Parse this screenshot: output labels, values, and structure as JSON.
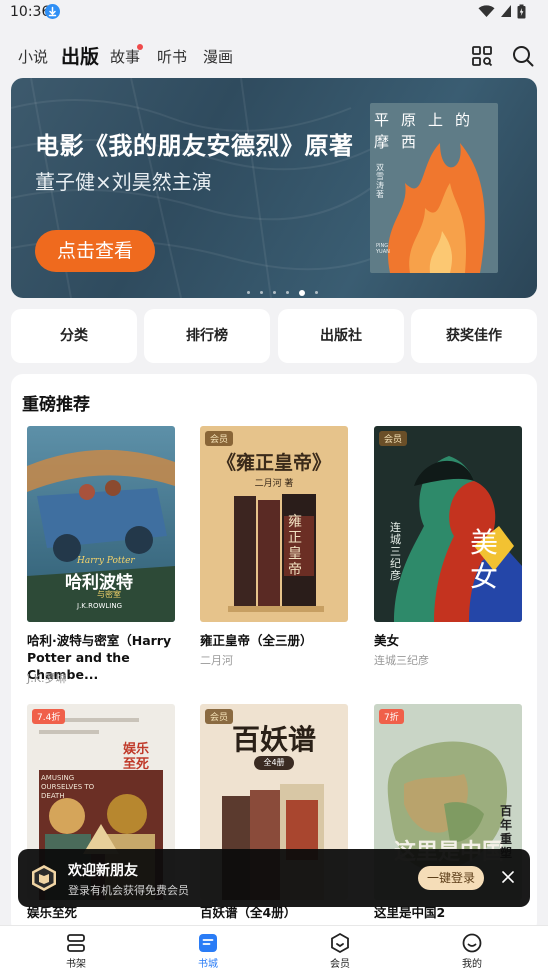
{
  "status_bar": {
    "time": "10:36"
  },
  "top_nav": {
    "tabs": [
      {
        "label": "小说",
        "active": false
      },
      {
        "label": "出版",
        "active": true
      },
      {
        "label": "故事",
        "active": false,
        "has_dot": true
      },
      {
        "label": "听书",
        "active": false
      },
      {
        "label": "漫画",
        "active": false
      }
    ],
    "icons": [
      "scan-icon",
      "search-icon"
    ]
  },
  "banner": {
    "title": "电影《我的朋友安德烈》原著",
    "subtitle": "董子健×刘昊然主演",
    "button_label": "点击查看",
    "cover": {
      "title_chars": "平原上的摩西",
      "author_vertical": "双雪涛 著",
      "small_print": "PING YUAN"
    },
    "dots": {
      "count": 6,
      "active_index": 4
    }
  },
  "quick_links": [
    "分类",
    "排行榜",
    "出版社",
    "获奖佳作"
  ],
  "recommend": {
    "title": "重磅推荐",
    "books": [
      {
        "title": "哈利·波特与密室（Harry Potter and the Chambe...",
        "author": "J.K.罗琳",
        "tag": "",
        "cover_text": {
          "brand": "Harry Potter",
          "zh": "哈利波特",
          "sub": "与密室",
          "author": "J.K.ROWLING"
        }
      },
      {
        "title": "雍正皇帝（全三册）",
        "author": "二月河",
        "tag": "会员",
        "cover_text": {
          "title": "《雍正皇帝》",
          "author": "二月河 著",
          "spine": "雍正皇帝"
        }
      },
      {
        "title": "美女",
        "author": "连城三纪彦",
        "tag": "会员",
        "cover_text": {
          "big": "美女",
          "author": "连城三纪彦"
        }
      },
      {
        "title": "娱乐至死",
        "author": "",
        "tag": "7.4折",
        "cover_text": {
          "zh": "娱乐至死",
          "en": "AMUSING OURSELVES TO DEATH"
        }
      },
      {
        "title": "百妖谱（全4册）",
        "author": "",
        "tag": "会员",
        "cover_text": {
          "title": "百妖谱",
          "badge": "全4册"
        }
      },
      {
        "title": "这里是中国2",
        "author": "",
        "tag": "7折",
        "cover_text": {
          "big": "这里是中国",
          "side": "百年重塑"
        }
      }
    ]
  },
  "toast": {
    "title": "欢迎新朋友",
    "subtitle": "登录有机会获得免费会员",
    "button_label": "一键登录"
  },
  "bottom_nav": {
    "items": [
      {
        "label": "书架",
        "icon": "bookshelf-icon",
        "active": false
      },
      {
        "label": "书城",
        "icon": "bookstore-icon",
        "active": true
      },
      {
        "label": "会员",
        "icon": "member-icon",
        "active": false
      },
      {
        "label": "我的",
        "icon": "profile-icon",
        "active": false
      }
    ]
  },
  "colors": {
    "accent_blue": "#2a7cf6",
    "banner_button": "#ef6a1e",
    "toast_button": "#f5ddb8",
    "background": "#f2f2f4"
  }
}
